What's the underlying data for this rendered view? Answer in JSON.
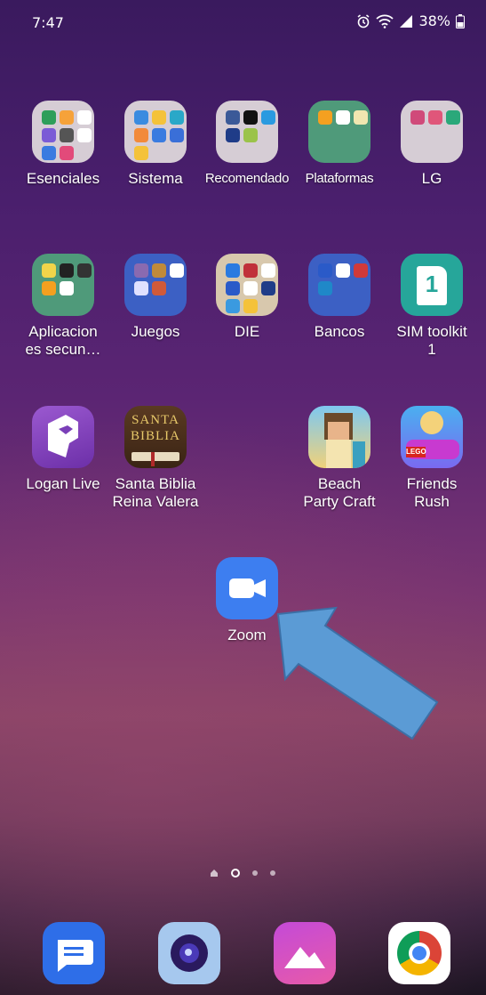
{
  "status": {
    "time": "7:47",
    "battery": "38%"
  },
  "apps": {
    "esenciales": "Esenciales",
    "sistema": "Sistema",
    "recomendado": "Recomendado",
    "plataformas": "Plataformas",
    "lg": "LG",
    "aplicaciones_line1": "Aplicacion",
    "aplicaciones_line2": "es secun…",
    "juegos": "Juegos",
    "die": "DIE",
    "bancos": "Bancos",
    "sim_line1": "SIM toolkit",
    "sim_line2": "1",
    "logan": "Logan Live",
    "biblia_line1": "Santa Biblia",
    "biblia_line2": "Reina Valera",
    "beach_line1": "Beach",
    "beach_line2": "Party Craft",
    "friends_line1": "Friends",
    "friends_line2": "Rush",
    "zoom": "Zoom"
  },
  "icon_text": {
    "sim": "1",
    "biblia_top": "SANTA",
    "biblia_bottom": "BIBLIA",
    "lego": "LEGO"
  },
  "colors": {
    "zoom": "#3d7ef0",
    "arrow": "#5b9bd5",
    "arrow_border": "#3c6fa6"
  },
  "pager": {
    "pages": 4,
    "current": 2
  },
  "dock": [
    "messages-icon",
    "camera-icon",
    "gallery-icon",
    "chrome-icon"
  ]
}
